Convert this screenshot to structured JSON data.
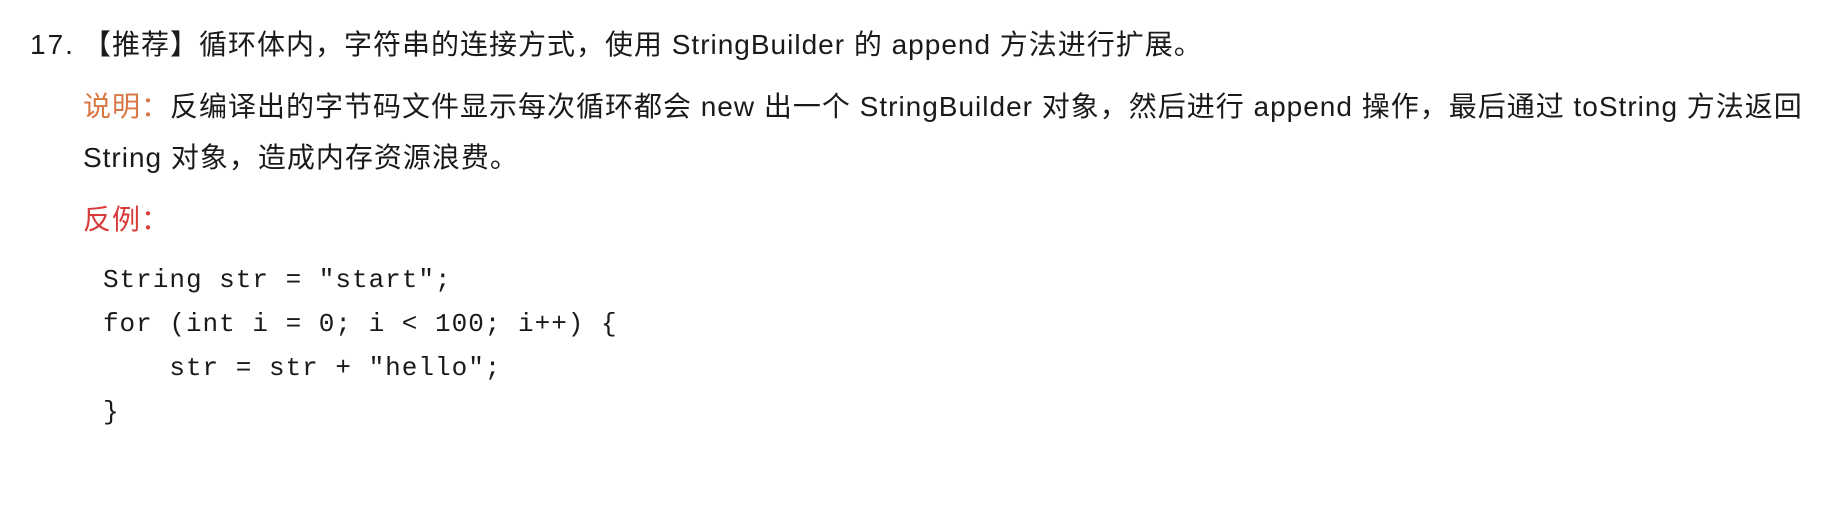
{
  "rule": {
    "number": "17.",
    "tag": "【推荐】",
    "title_rest": "循环体内，字符串的连接方式，使用 StringBuilder 的 append 方法进行扩展。"
  },
  "explanation": {
    "label": "说明：",
    "text": "反编译出的字节码文件显示每次循环都会 new 出一个 StringBuilder 对象，然后进行 append 操作，最后通过 toString 方法返回 String 对象，造成内存资源浪费。"
  },
  "counter_example": {
    "label": "反例：",
    "code": "String str = \"start\";\nfor (int i = 0; i < 100; i++) {\n    str = str + \"hello\";\n}"
  }
}
